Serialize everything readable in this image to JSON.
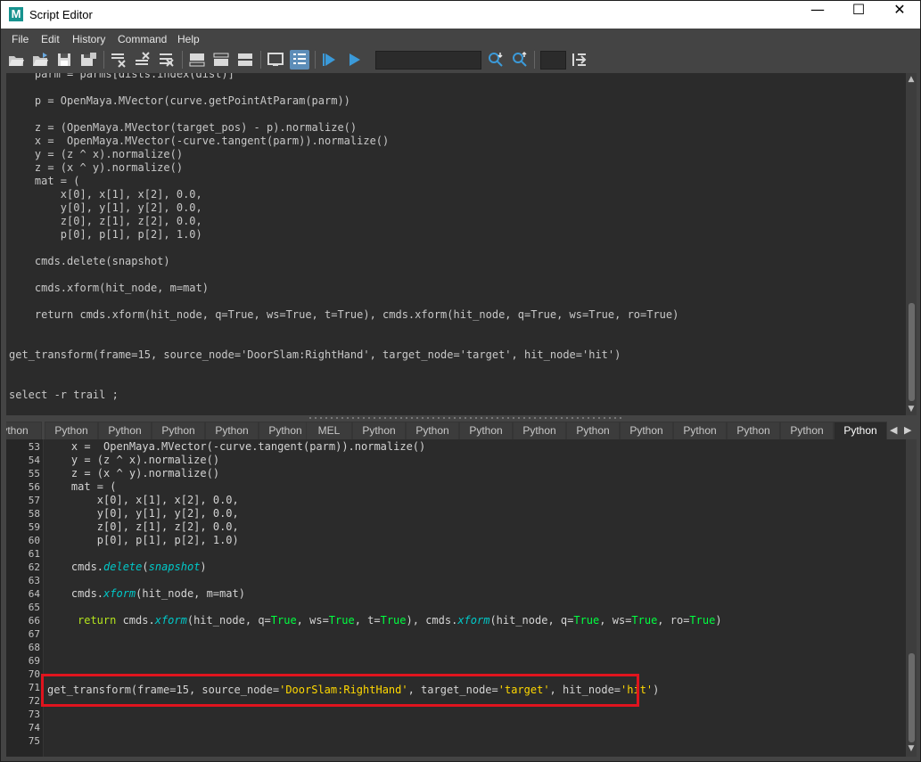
{
  "window": {
    "title": "Script Editor",
    "controls": {
      "minimize": "—",
      "maximize": "☐",
      "close": "✕"
    }
  },
  "menu": [
    "File",
    "Edit",
    "History",
    "Command",
    "Help"
  ],
  "toolbar": {
    "icons": [
      "open-script-icon",
      "source-script-icon",
      "save-script-icon",
      "save-script-to-shelf-icon",
      "clear-history-icon",
      "clear-input-icon",
      "clear-all-icon",
      "show-history-icon",
      "show-input-icon",
      "show-both-icon",
      "echo-all-commands-icon",
      "execute-all-icon",
      "execute-icon",
      "search-down-icon",
      "search-up-icon",
      "line-number-box",
      "goto-line-icon"
    ],
    "search_value": "",
    "line_value": ""
  },
  "history": {
    "lines": [
      "    parm = parms[dists.index(dist)]",
      "",
      "    p = OpenMaya.MVector(curve.getPointAtParam(parm))",
      "",
      "    z = (OpenMaya.MVector(target_pos) - p).normalize()",
      "    x =  OpenMaya.MVector(-curve.tangent(parm)).normalize()",
      "    y = (z ^ x).normalize()",
      "    z = (x ^ y).normalize()",
      "    mat = (",
      "        x[0], x[1], x[2], 0.0,",
      "        y[0], y[1], y[2], 0.0,",
      "        z[0], z[1], z[2], 0.0,",
      "        p[0], p[1], p[2], 1.0)",
      "",
      "    cmds.delete(snapshot)",
      "",
      "    cmds.xform(hit_node, m=mat)",
      "",
      "    return cmds.xform(hit_node, q=True, ws=True, t=True), cmds.xform(hit_node, q=True, ws=True, ro=True)",
      "",
      "",
      "get_transform(frame=15, source_node='DoorSlam:RightHand', target_node='target', hit_node='hit')",
      "",
      "",
      "select -r trail ;"
    ]
  },
  "tabs": [
    "ython",
    "Python",
    "Python",
    "Python",
    "Python",
    "Python",
    "MEL",
    "Python",
    "Python",
    "Python",
    "Python",
    "Python",
    "Python",
    "Python",
    "Python",
    "Python"
  ],
  "editor": {
    "line_numbers": [
      "53",
      "54",
      "55",
      "56",
      "57",
      "58",
      "59",
      "60",
      "61",
      "62",
      "63",
      "64",
      "65",
      "66",
      "67",
      "68",
      "69",
      "70",
      "71",
      "72",
      "73",
      "74",
      "75"
    ],
    "t": {
      "l53a": "    x =  OpenMaya.MVector(-curve.tangent(parm)).normalize()",
      "l54": "    y = (z ^ x).normalize()",
      "l55": "    z = (x ^ y).normalize()",
      "l56": "    mat = (",
      "l57": "        x[0], x[1], x[2], 0.0,",
      "l58": "        y[0], y[1], y[2], 0.0,",
      "l59": "        z[0], z[1], z[2], 0.0,",
      "l60": "        p[0], p[1], p[2], 1.0)",
      "l62a": "    cmds.",
      "l62b": "delete",
      "l62c": "(",
      "l62d": "snapshot",
      "l62e": ")",
      "l64a": "    cmds.",
      "l64b": "xform",
      "l64c": "(hit_node, m=mat)",
      "l66a": "return",
      "l66b": " cmds.",
      "l66c": "xform",
      "l66d": "(hit_node, q=",
      "l66e": "True",
      "l66f": ", ws=",
      "l66g": "True",
      "l66h": ", t=",
      "l66i": "True",
      "l66j": "), cmds.",
      "l66k": "xform",
      "l66l": "(hit_node, q=",
      "l66m": "True",
      "l66n": ", ws=",
      "l66o": "True",
      "l66p": ", ro=",
      "l66q": "True",
      "l66r": ")",
      "l71a": "get_transform(frame=15, source_node=",
      "l71b": "'DoorSlam:RightHand'",
      "l71c": ", target_node=",
      "l71d": "'target'",
      "l71e": ", hit_node=",
      "l71f": "'hit'",
      "l71g": ")"
    }
  },
  "colors": {
    "highlight_box": "#e0141e",
    "keyword": "#b5e61d",
    "function": "#00c8c8",
    "string": "#ffd800",
    "boolean": "#00ff40"
  }
}
